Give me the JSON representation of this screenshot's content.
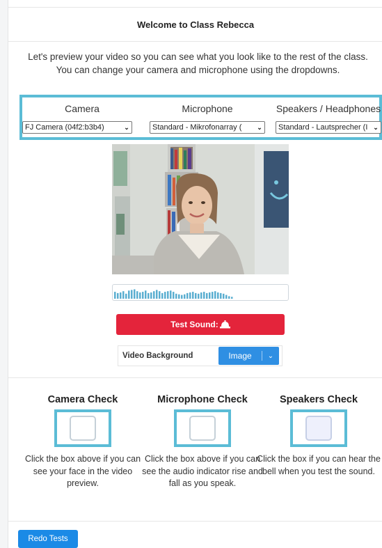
{
  "header": {
    "title": "Welcome to Class Rebecca"
  },
  "intro": {
    "text": "Let's preview your video so you can see what you look like to the rest of the class.  You can change your camera and microphone using the dropdowns."
  },
  "devices": {
    "camera": {
      "label": "Camera",
      "selected": "FJ Camera (04f2:b3b4)"
    },
    "microphone": {
      "label": "Microphone",
      "selected": "Standard - Mikrofonarray ("
    },
    "speakers": {
      "label": "Speakers / Headphones",
      "selected": "Standard - Lautsprecher (I"
    }
  },
  "test_sound": {
    "label": "Test Sound:"
  },
  "video_background": {
    "label": "Video Background",
    "button": "Image"
  },
  "checks": {
    "camera": {
      "title": "Camera Check",
      "desc": "Click the box above if you can see your face in the video preview."
    },
    "microphone": {
      "title": "Microphone Check",
      "desc": "Click the box above if you can see the audio indicator rise and fall as you speak."
    },
    "speakers": {
      "title": "Speakers Check",
      "desc": "Click the box if you can hear the bell  when you test the sound."
    }
  },
  "redo": {
    "label": "Redo Tests"
  },
  "colors": {
    "highlight": "#5bbcd6",
    "test_sound": "#e4243b",
    "primary": "#1b8ae6",
    "meter": "#5aaed0"
  },
  "icons": [
    "chevron-down-icon",
    "bell-icon"
  ],
  "audio_levels": [
    0.55,
    0.45,
    0.5,
    0.6,
    0.4,
    0.65,
    0.7,
    0.75,
    0.6,
    0.5,
    0.55,
    0.65,
    0.45,
    0.5,
    0.6,
    0.7,
    0.6,
    0.45,
    0.55,
    0.6,
    0.65,
    0.55,
    0.4,
    0.35,
    0.3,
    0.35,
    0.45,
    0.5,
    0.55,
    0.45,
    0.4,
    0.5,
    0.55,
    0.45,
    0.5,
    0.55,
    0.6,
    0.5,
    0.45,
    0.4,
    0.3,
    0.2,
    0.15
  ]
}
